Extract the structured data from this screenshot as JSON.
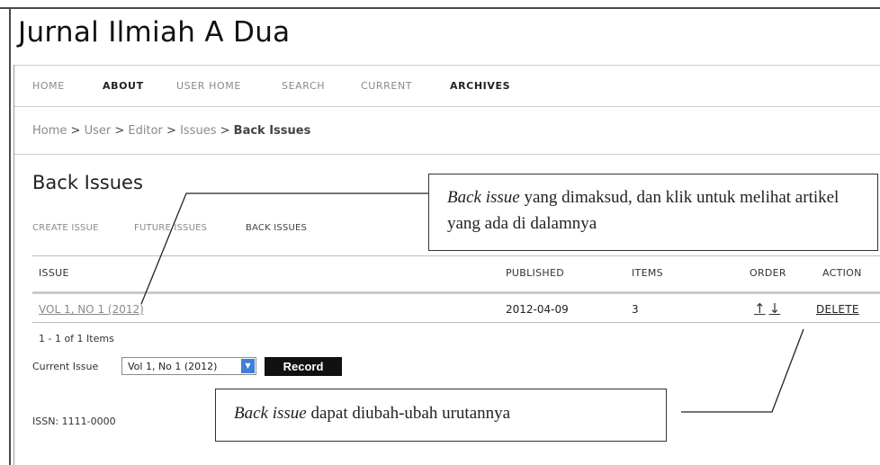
{
  "site": {
    "title": "Jurnal Ilmiah A Dua"
  },
  "nav": {
    "items": [
      {
        "label": "HOME"
      },
      {
        "label": "ABOUT"
      },
      {
        "label": "USER HOME"
      },
      {
        "label": "SEARCH"
      },
      {
        "label": "CURRENT"
      },
      {
        "label": "ARCHIVES"
      }
    ]
  },
  "breadcrumb": {
    "items": [
      "Home",
      "User",
      "Editor",
      "Issues"
    ],
    "current": "Back Issues",
    "separator": ">"
  },
  "page": {
    "title": "Back Issues"
  },
  "subnav": {
    "items": [
      {
        "label": "CREATE ISSUE"
      },
      {
        "label": "FUTURE ISSUES"
      },
      {
        "label": "BACK ISSUES"
      }
    ]
  },
  "table": {
    "headers": [
      "ISSUE",
      "PUBLISHED",
      "ITEMS",
      "ORDER",
      "ACTION"
    ],
    "rows": [
      {
        "issue": "VOL 1, NO 1 (2012)",
        "published": "2012-04-09",
        "items": "3",
        "order_up": "↑",
        "order_down": "↓",
        "action": "DELETE"
      }
    ]
  },
  "pager": {
    "text": "1 - 1 of 1 Items"
  },
  "current_issue": {
    "label": "Current Issue",
    "selected": "Vol 1, No 1 (2012)",
    "button": "Record"
  },
  "issn": {
    "text": "ISSN: 1111-0000"
  },
  "annotations": {
    "top": {
      "emph": "Back issue",
      "rest": " yang dimaksud, dan klik untuk melihat artikel yang ada di dalamnya"
    },
    "bottom": {
      "emph": "Back issue",
      "rest": " dapat diubah-ubah urutannya"
    }
  },
  "colors": {
    "frame": "#4a4a4a",
    "muted_text": "#8a8a8a",
    "select_accent": "#3f7fd6",
    "button_bg": "#111111"
  }
}
